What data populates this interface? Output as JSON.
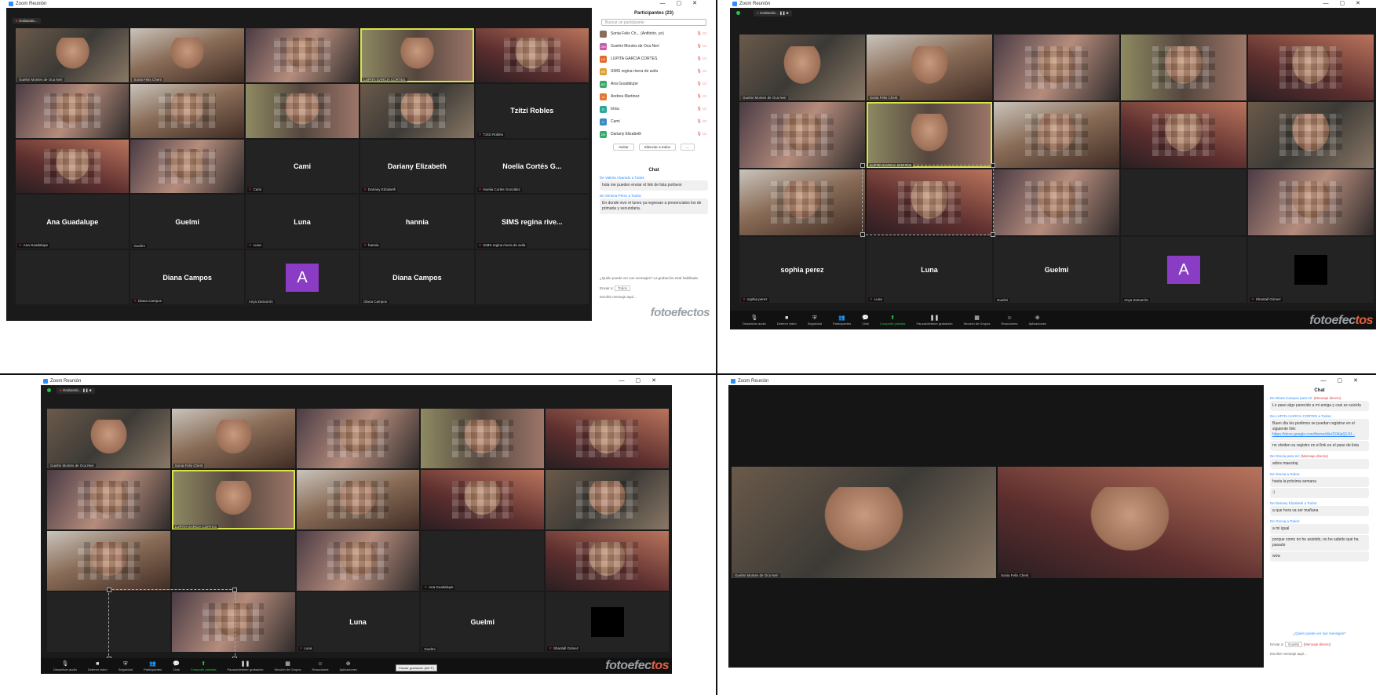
{
  "app": {
    "window_title": "Zoom Reunión",
    "recording_label": "Grabando..."
  },
  "toolbar": {
    "audio": "Desactivar audio",
    "video": "Detener video",
    "security": "Seguridad",
    "participants": "Participantes",
    "participants_count": "23",
    "chat": "Chat",
    "share": "Compartir pantalla",
    "pause_recording": "Pausar/detener grabación",
    "breakout": "Sección de Grupos",
    "reactions": "Reacciones",
    "apps": "Aplicaciones",
    "tooltip": "Pausar grabación (Alt+P)"
  },
  "watermark": {
    "main": "fotoefec",
    "accent": "tos",
    "full": "fotoefectos"
  },
  "q1": {
    "tiles": [
      {
        "type": "video",
        "cls": "video",
        "name": "Guelmi Montes de Oca Neri"
      },
      {
        "type": "video",
        "cls": "v2",
        "name": "Sonia Felix Cherit"
      },
      {
        "type": "video",
        "cls": "v3",
        "name": ""
      },
      {
        "type": "video",
        "cls": "v4",
        "name": "LUPITA GARCIA CORTES",
        "active": true
      },
      {
        "type": "video",
        "cls": "v5",
        "name": ""
      },
      {
        "type": "video",
        "cls": "v3",
        "name": ""
      },
      {
        "type": "video",
        "cls": "v2",
        "name": ""
      },
      {
        "type": "video",
        "cls": "v4",
        "name": ""
      },
      {
        "type": "video",
        "cls": "video",
        "name": ""
      },
      {
        "type": "text",
        "big": "Tzitzi Robles",
        "name": "Tzitzi Robles",
        "muted": true
      },
      {
        "type": "video",
        "cls": "v5",
        "name": ""
      },
      {
        "type": "video",
        "cls": "v3",
        "name": ""
      },
      {
        "type": "text",
        "big": "Cami",
        "name": "Cami",
        "muted": true
      },
      {
        "type": "text",
        "big": "Dariany Elizabeth",
        "name": "Dariany Elizabeth",
        "muted": true
      },
      {
        "type": "text",
        "big": "Noelia Cortés G...",
        "name": "Noelia Cortés González",
        "muted": true
      },
      {
        "type": "text",
        "big": "Ana Guadalupe",
        "name": "Ana Guadalupe",
        "muted": true
      },
      {
        "type": "text",
        "big": "Guelmi",
        "name": "Guelmi"
      },
      {
        "type": "text",
        "big": "Luna",
        "name": "Luna",
        "muted": true
      },
      {
        "type": "text",
        "big": "hannia",
        "name": "hannia",
        "muted": true
      },
      {
        "type": "text",
        "big": "SIMS regina rive...",
        "name": "SIMS regina rivera de avila",
        "muted": true
      },
      {
        "type": "empty"
      },
      {
        "type": "text",
        "big": "Diana Campos",
        "name": "Diana Campos",
        "muted": true
      },
      {
        "type": "avatar",
        "letter": "A",
        "name": "Anya Zamarrón"
      },
      {
        "type": "text",
        "big": "Diana Campos",
        "name": "Diana Campos"
      },
      {
        "type": "empty"
      }
    ],
    "participants_title": "Participantes (23)",
    "search_placeholder": "Buscar un participante",
    "participants": [
      {
        "initials": "",
        "color": "#8a6d58",
        "name": "Sonia Felix Ch... (Anfitrión, yo)"
      },
      {
        "initials": "GM",
        "color": "#c45aa8",
        "name": "Guelmi Montes de Oca Neri"
      },
      {
        "initials": "LR",
        "color": "#e06a30",
        "name": "LUPITA GARCIA CORTES"
      },
      {
        "initials": "SR",
        "color": "#e0a030",
        "name": "SIMS regina rivera de avila"
      },
      {
        "initials": "AG",
        "color": "#38a86a",
        "name": "Ana Guadalupe"
      },
      {
        "initials": "A",
        "color": "#e07a30",
        "name": "Andrea Martinez"
      },
      {
        "initials": "B",
        "color": "#2aa89a",
        "name": "brisa"
      },
      {
        "initials": "C",
        "color": "#3a8ac4",
        "name": "Cami"
      },
      {
        "initials": "DE",
        "color": "#38a86a",
        "name": "Dariany Elizabeth"
      }
    ],
    "invite": "Invitar",
    "mute_all": "Silenciar a todos",
    "more": "...",
    "chat_title": "Chat",
    "chat": [
      {
        "from": "De Valeria Alvarado a Todos:",
        "msg": "hola me pueden enviar el link de lista porfavor"
      },
      {
        "from": "De Ximena Pérez a Todos:",
        "msg": "En donde vivo el lunes ya regresan a presenciales los de primaria y secundaria."
      }
    ],
    "chat_notice": "¿Quién puede ver sus mensajes? La grabación está habilitada",
    "send_to": "Enviar a:",
    "send_to_value": "Todos",
    "chat_placeholder": "Escribir mensaje aquí..."
  },
  "q2": {
    "tiles": [
      {
        "type": "video",
        "cls": "video",
        "name": "Guelmi Montes de Oca Neri"
      },
      {
        "type": "video",
        "cls": "v2",
        "name": "Sonia Felix Cherit"
      },
      {
        "type": "video",
        "cls": "v3",
        "name": ""
      },
      {
        "type": "video",
        "cls": "v4",
        "name": ""
      },
      {
        "type": "video",
        "cls": "v5",
        "name": ""
      },
      {
        "type": "video",
        "cls": "v3",
        "name": ""
      },
      {
        "type": "video",
        "cls": "v4",
        "name": "LUPITA GARCIA CORTES",
        "active": true
      },
      {
        "type": "video",
        "cls": "v2",
        "name": ""
      },
      {
        "type": "video",
        "cls": "v5",
        "name": ""
      },
      {
        "type": "video",
        "cls": "video",
        "name": ""
      },
      {
        "type": "video",
        "cls": "v2",
        "name": ""
      },
      {
        "type": "video",
        "cls": "v5",
        "name": ""
      },
      {
        "type": "video",
        "cls": "v3",
        "name": ""
      },
      {
        "type": "empty"
      },
      {
        "type": "video",
        "cls": "v3",
        "name": ""
      },
      {
        "type": "text",
        "big": "sophia perez",
        "name": "sophia perez",
        "muted": true
      },
      {
        "type": "text",
        "big": "Luna",
        "name": "Luna",
        "muted": true
      },
      {
        "type": "text",
        "big": "Guelmi",
        "name": "Guelmi"
      },
      {
        "type": "avatar",
        "letter": "A",
        "name": "Anya Zamarrón"
      },
      {
        "type": "black",
        "name": "Shantall Gómez",
        "muted": true
      }
    ]
  },
  "q3": {
    "tiles": [
      {
        "type": "video",
        "cls": "video",
        "name": "Guelmi Montes de Oca Neri"
      },
      {
        "type": "video",
        "cls": "v2",
        "name": "Sonia Felix Cherit"
      },
      {
        "type": "video",
        "cls": "v3",
        "name": ""
      },
      {
        "type": "video",
        "cls": "v4",
        "name": ""
      },
      {
        "type": "video",
        "cls": "v5",
        "name": ""
      },
      {
        "type": "video",
        "cls": "v3",
        "name": ""
      },
      {
        "type": "video",
        "cls": "v4",
        "name": "LUPITA GARCIA CORTES",
        "active": true
      },
      {
        "type": "video",
        "cls": "v2",
        "name": ""
      },
      {
        "type": "video",
        "cls": "v5",
        "name": ""
      },
      {
        "type": "video",
        "cls": "video",
        "name": ""
      },
      {
        "type": "video",
        "cls": "v2",
        "name": ""
      },
      {
        "type": "empty"
      },
      {
        "type": "video",
        "cls": "v3",
        "name": ""
      },
      {
        "type": "empty",
        "name": "Ana Guadalupe",
        "muted": true
      },
      {
        "type": "video",
        "cls": "v5",
        "name": ""
      },
      {
        "type": "empty"
      },
      {
        "type": "video",
        "cls": "v3",
        "name": ""
      },
      {
        "type": "text",
        "big": "Luna",
        "name": "Luna",
        "muted": true
      },
      {
        "type": "text",
        "big": "Guelmi",
        "name": "Guelmi"
      },
      {
        "type": "black",
        "name": "Shantall Gómez",
        "muted": true
      }
    ]
  },
  "q4": {
    "speakers": [
      {
        "cls": "video",
        "name": "Guelmi Montes de Oca Neri"
      },
      {
        "cls": "v5",
        "name": "Sonia Felix Cherit"
      }
    ],
    "chat_title": "Chat",
    "chat": [
      {
        "from": "De Diana Campos para mí:",
        "dm": "(Mensaje directo)",
        "msg": "Lo paso algo parecido a mi amiga y casi se suicida"
      },
      {
        "from": "De LUPITA GARCIA CORTES a Todos:",
        "msg": "Buen día les pedimos se puedan registrar en el siguiente link:",
        "link": "https://docs.google.com/forms/d/e/1FAIpQLSf..."
      },
      {
        "from": "",
        "msg": "no olviden su registro en el link es el pase de lista"
      },
      {
        "from": "De Grecia para mí:",
        "dm": "(Mensaje directo)",
        "msg": "adios maestraj"
      },
      {
        "from": "De Grecia a Todos:",
        "msg": "hasta la próxima semana"
      },
      {
        "from": "",
        "msg": ":)"
      },
      {
        "from": "De Dariany Elizabeth a Todos:",
        "msg": "a que hora va ser mañana"
      },
      {
        "from": "De Grecia a Todos:",
        "msg": "a mi igual"
      },
      {
        "from": "",
        "msg": "porque como no he asistido, no he sabido qué ha pasado"
      },
      {
        "from": "",
        "msg": "wow"
      }
    ],
    "chat_notice": "¿Quién puede ver sus mensajes?",
    "send_to": "Enviar a:",
    "send_to_value": "Guelmi",
    "dm_label": "(Mensaje directo)",
    "chat_placeholder": "Escribir mensaje aquí..."
  }
}
